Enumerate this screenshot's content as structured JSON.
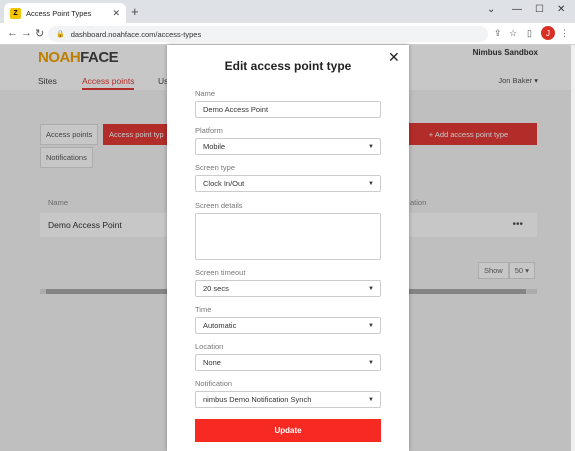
{
  "browser": {
    "tab_title": "Access Point Types",
    "url": "dashboard.noahface.com/access-types",
    "profile_initial": "J"
  },
  "app": {
    "logo_part1": "NOAH",
    "logo_part2": "FACE",
    "sandbox": "Nimbus Sandbox",
    "user": "Jon Baker ▾",
    "nav": [
      "Sites",
      "Access points",
      "Us"
    ],
    "subtabs": [
      "Access points",
      "Access point typ",
      "Notifications"
    ],
    "add_button": "+ Add access point type",
    "table_header_name": "Name",
    "table_header_loc": "ation",
    "row_name": "Demo Access Point",
    "show_label": "Show",
    "show_value": "50 ▾"
  },
  "modal": {
    "title": "Edit access point type",
    "fields": {
      "name_label": "Name",
      "name_value": "Demo Access Point",
      "platform_label": "Platform",
      "platform_value": "Mobile",
      "screen_type_label": "Screen type",
      "screen_type_value": "Clock In/Out",
      "screen_details_label": "Screen details",
      "screen_timeout_label": "Screen timeout",
      "screen_timeout_value": "20 secs",
      "time_label": "Time",
      "time_value": "Automatic",
      "location_label": "Location",
      "location_value": "None",
      "notification_label": "Notification",
      "notification_value": "nimbus Demo Notification Synch"
    },
    "update_label": "Update"
  },
  "colors": {
    "accent": "#e53935",
    "update": "#f62a22",
    "logo_orange": "#f4a300"
  }
}
